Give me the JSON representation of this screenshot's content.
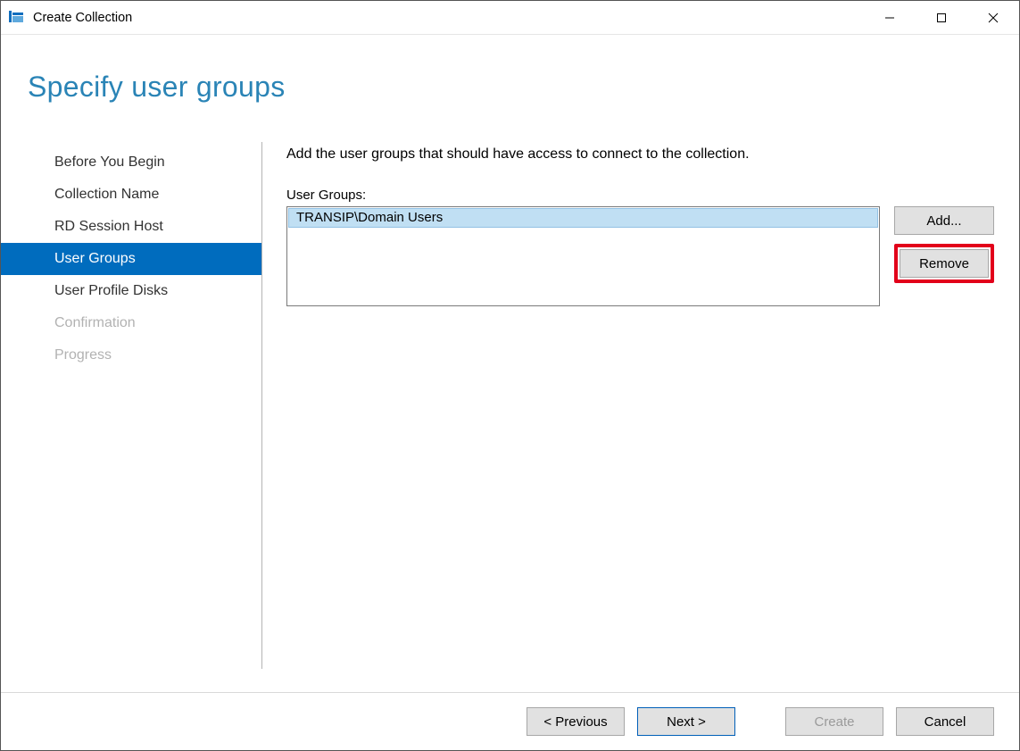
{
  "window": {
    "title": "Create Collection"
  },
  "page": {
    "heading": "Specify user groups",
    "instruction": "Add the user groups that should have access to connect to the collection.",
    "list_label": "User Groups:"
  },
  "sidebar": {
    "items": [
      {
        "label": "Before You Begin",
        "state": "normal"
      },
      {
        "label": "Collection Name",
        "state": "normal"
      },
      {
        "label": "RD Session Host",
        "state": "normal"
      },
      {
        "label": "User Groups",
        "state": "active"
      },
      {
        "label": "User Profile Disks",
        "state": "normal"
      },
      {
        "label": "Confirmation",
        "state": "disabled"
      },
      {
        "label": "Progress",
        "state": "disabled"
      }
    ]
  },
  "user_groups": {
    "items": [
      {
        "name": "TRANSIP\\Domain Users",
        "selected": true
      }
    ],
    "add_label": "Add...",
    "remove_label": "Remove"
  },
  "footer": {
    "previous": "< Previous",
    "next": "Next >",
    "create": "Create",
    "cancel": "Cancel"
  }
}
